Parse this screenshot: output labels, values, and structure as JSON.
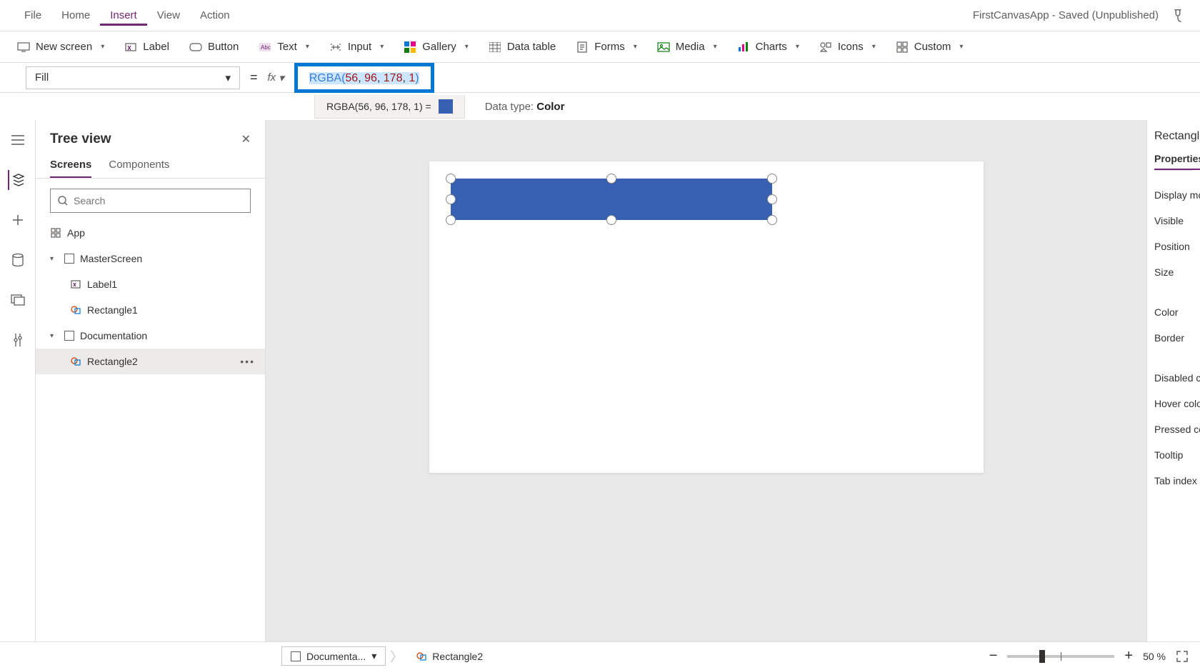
{
  "menu": {
    "file": "File",
    "home": "Home",
    "insert": "Insert",
    "view": "View",
    "action": "Action"
  },
  "appTitle": "FirstCanvasApp - Saved (Unpublished)",
  "ribbon": {
    "newScreen": "New screen",
    "label": "Label",
    "button": "Button",
    "text": "Text",
    "input": "Input",
    "gallery": "Gallery",
    "dataTable": "Data table",
    "forms": "Forms",
    "media": "Media",
    "charts": "Charts",
    "icons": "Icons",
    "custom": "Custom"
  },
  "formula": {
    "property": "Fill",
    "fx": "fx",
    "fn": "RGBA",
    "args": [
      "56",
      "96",
      "178",
      "1"
    ],
    "resultText": "RGBA(56, 96, 178, 1)  =",
    "dataTypeLabel": "Data type: ",
    "dataType": "Color"
  },
  "tree": {
    "title": "Tree view",
    "tabs": {
      "screens": "Screens",
      "components": "Components"
    },
    "searchPlaceholder": "Search",
    "app": "App",
    "items": [
      {
        "name": "MasterScreen",
        "children": [
          {
            "name": "Label1",
            "kind": "label"
          },
          {
            "name": "Rectangle1",
            "kind": "shape"
          }
        ]
      },
      {
        "name": "Documentation",
        "children": [
          {
            "name": "Rectangle2",
            "kind": "shape",
            "selected": true
          }
        ]
      }
    ]
  },
  "properties": {
    "controlName": "Rectangle",
    "tabs": {
      "properties": "Properties"
    },
    "rows": [
      "Display mode",
      "Visible",
      "Position",
      "Size",
      "Color",
      "Border",
      "Disabled color",
      "Hover color",
      "Pressed color",
      "Tooltip",
      "Tab index"
    ]
  },
  "status": {
    "screen": "Documenta...",
    "control": "Rectangle2",
    "zoom": "50  %"
  }
}
